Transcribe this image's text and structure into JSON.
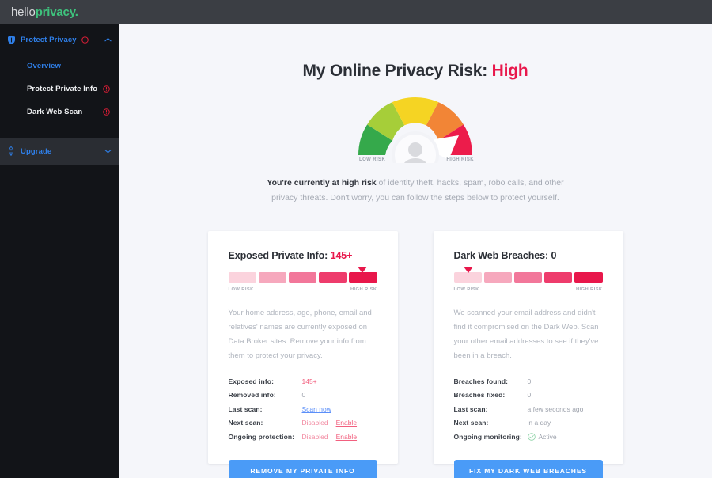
{
  "brand": {
    "part1": "hello",
    "part2": "privacy."
  },
  "sidebar": {
    "group": {
      "label": "Protect Privacy",
      "icon": "shield-icon",
      "alert_icon": "alert-circle-icon",
      "chevron": "chevron-up-icon"
    },
    "items": [
      {
        "label": "Overview",
        "active": true,
        "alert": false
      },
      {
        "label": "Protect Private Info",
        "active": false,
        "alert": true
      },
      {
        "label": "Dark Web Scan",
        "active": false,
        "alert": true
      }
    ],
    "upgrade": {
      "label": "Upgrade",
      "icon": "rocket-icon",
      "chevron": "chevron-down-icon"
    },
    "colors": {
      "accent": "#2f7fe8",
      "alert": "#e01e37",
      "bg": "#121418",
      "upgrade_bg": "#2a2d33"
    }
  },
  "main": {
    "title_prefix": "My Online Privacy Risk: ",
    "title_risk": "High",
    "gauge": {
      "low_label": "LOW RISK",
      "high_label": "HIGH RISK",
      "needle_level": 5,
      "segments": 5,
      "colors": [
        "#35a94b",
        "#a6ce39",
        "#f5d423",
        "#f28536",
        "#ec1c4b"
      ]
    },
    "lede_bold": "You're currently at high risk",
    "lede_rest": " of identity theft, hacks, spam, robo calls, and other privacy threats. Don't worry, you can follow the steps below to protect yourself."
  },
  "cards": [
    {
      "title_label": "Exposed Private Info: ",
      "title_value": "145+",
      "title_value_color": "red",
      "meter": {
        "low_label": "LOW RISK",
        "high_label": "HIGH RISK",
        "marker_segment": 5,
        "segments": 5,
        "colors": [
          "#fbd3dd",
          "#f6a8bd",
          "#f2779a",
          "#ee3c6c",
          "#e8174b"
        ]
      },
      "blurb": "Your home address, age, phone, email and relatives' names are currently exposed on Data Broker sites. Remove your info from them to protect your privacy.",
      "rows": [
        {
          "key": "Exposed info:",
          "value": "145+",
          "style": "red"
        },
        {
          "key": "Removed info:",
          "value": "0",
          "style": "plain"
        },
        {
          "key": "Last scan:",
          "value": "Scan now",
          "style": "link-blue"
        },
        {
          "key": "Next scan:",
          "value": "Disabled",
          "style": "pink",
          "action": "Enable"
        },
        {
          "key": "Ongoing protection:",
          "value": "Disabled",
          "style": "pink",
          "action": "Enable"
        }
      ],
      "cta": "REMOVE MY PRIVATE INFO"
    },
    {
      "title_label": "Dark Web Breaches: ",
      "title_value": "0",
      "title_value_color": "dark",
      "meter": {
        "low_label": "LOW RISK",
        "high_label": "HIGH RISK",
        "marker_segment": 1,
        "segments": 5,
        "colors": [
          "#fbd3dd",
          "#f6a8bd",
          "#f2779a",
          "#ee3c6c",
          "#e8174b"
        ]
      },
      "blurb": "We scanned your email address and didn't find it compromised on the Dark Web. Scan your other email addresses to see if they've been in a breach.",
      "rows": [
        {
          "key": "Breaches found:",
          "value": "0",
          "style": "plain"
        },
        {
          "key": "Breaches fixed:",
          "value": "0",
          "style": "plain"
        },
        {
          "key": "Last scan:",
          "value": "a few seconds ago",
          "style": "plain"
        },
        {
          "key": "Next scan:",
          "value": "in a day",
          "style": "plain"
        },
        {
          "key": "Ongoing monitoring:",
          "value": "Active",
          "style": "check",
          "icon": "check-circle-icon"
        }
      ],
      "cta": "FIX MY DARK WEB BREACHES"
    }
  ]
}
